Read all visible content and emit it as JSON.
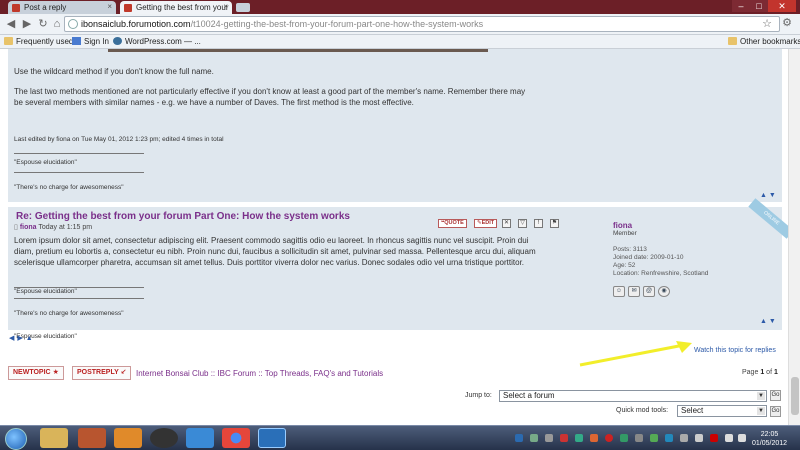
{
  "browser": {
    "tabs": [
      {
        "title": "Post a reply",
        "active": false
      },
      {
        "title": "Getting the best from your",
        "active": true
      }
    ],
    "url_host": "ibonsaiclub.forumotion.com",
    "url_path": "/t10024-getting-the-best-from-your-forum-part-one-how-the-system-works",
    "bookmarks": [
      "Frequently used",
      "Sign In",
      "WordPress.com — ..."
    ],
    "other_bookmarks": "Other bookmarks"
  },
  "post1": {
    "para1": "Use the wildcard method if you don't know the full name.",
    "para2_line1": "The last two methods mentioned are not particularly effective if you don't know at least a good part of the member's name. Remember there may",
    "para2_line2": "be several members with similar names - e.g. we have a number of Daves. The first method is the most effective.",
    "edited_note": "Last edited by fiona on Tue May 01, 2012 1:23 pm; edited 4 times in total",
    "sig1": "\"Espouse elucidation\"",
    "sig2": "\"There's no charge for awesomeness\""
  },
  "post2": {
    "title": "Re: Getting the best from your forum Part One: How the system works",
    "author": "fiona",
    "date": "Today at 1:15 pm",
    "body_lines": [
      "Lorem ipsum dolor sit amet, consectetur adipiscing elit. Praesent commodo sagittis odio eu laoreet. In rhoncus sagittis nunc vel suscipit. Proin dui",
      "diam, pretium eu lobortis a, consectetur eu nibh. Proin nunc dui, faucibus a sollicitudin sit amet, pulvinar sed massa. Pellentesque arcu dui, aliquam",
      "scelerisque ullamcorper pharetra, accumsan sit amet tellus. Duis porttitor viverra dolor nec varius. Donec sodales odio vel urna tristique porttitor."
    ],
    "sig1": "\"Espouse elucidation\"",
    "sig2": "\"There's no charge for awesomeness\"",
    "quote_label": "QUOTE",
    "edit_label": "EDIT",
    "online_label": "ONLINE"
  },
  "profile": {
    "name": "fiona",
    "rank": "Member",
    "posts": "Posts: 3113",
    "joined": "Joined date: 2009-01-10",
    "age": "Age: 52",
    "location": "Location: Renfrewshire, Scotland"
  },
  "footer": {
    "watch_link": "Watch this topic for replies",
    "newtopic": "NEWTOPIC",
    "postreply": "POSTREPLY",
    "breadcrumb": "Internet Bonsai Club :: IBC Forum :: Top Threads, FAQ's and Tutorials",
    "page_prefix": "Page",
    "page_current": "1",
    "page_of": "of",
    "page_total": "1",
    "jump_label": "Jump to:",
    "jump_value": "Select a forum",
    "quick_label": "Quick mod tools:",
    "quick_value": "Select",
    "go_label": "Go"
  },
  "taskbar": {
    "time": "22:05",
    "date": "01/05/2012"
  }
}
